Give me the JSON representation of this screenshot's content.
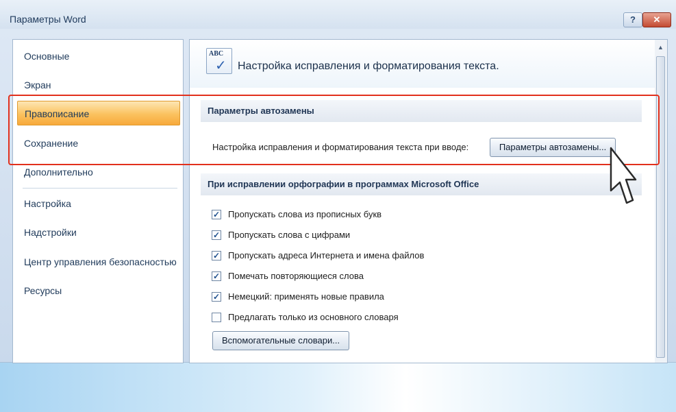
{
  "window": {
    "title": "Параметры Word",
    "help_label": "?",
    "close_label": "✕"
  },
  "sidebar": {
    "items": [
      {
        "label": "Основные"
      },
      {
        "label": "Экран"
      },
      {
        "label": "Правописание"
      },
      {
        "label": "Сохранение"
      },
      {
        "label": "Дополнительно"
      },
      {
        "label": "Настройка"
      },
      {
        "label": "Надстройки"
      },
      {
        "label": "Центр управления безопасностью"
      },
      {
        "label": "Ресурсы"
      }
    ],
    "selected": "Правописание"
  },
  "content": {
    "header_icon": "abc-check-icon",
    "header_icon_text": "ABC",
    "header_text": "Настройка исправления и форматирования текста.",
    "autocorrect_section": {
      "title": "Параметры автозамены",
      "description": "Настройка исправления и форматирования текста при вводе:",
      "button_label": "Параметры автозамены..."
    },
    "office_section": {
      "title": "При исправлении орфографии в программах Microsoft Office",
      "options": [
        {
          "label": "Пропускать слова из прописных букв",
          "checked": true
        },
        {
          "label": "Пропускать слова с цифрами",
          "checked": true
        },
        {
          "label": "Пропускать адреса Интернета и имена файлов",
          "checked": true
        },
        {
          "label": "Помечать повторяющиеся слова",
          "checked": true
        },
        {
          "label": "Немецкий: применять новые правила",
          "checked": true
        },
        {
          "label": "Предлагать только из основного словаря",
          "checked": false
        }
      ],
      "dictionaries_button": "Вспомогательные словари..."
    }
  },
  "scrollbar": {
    "up_arrow": "▲"
  },
  "colors": {
    "selected_nav": "#fbc25f",
    "highlight_frame": "#e2301c",
    "check_mark": "#1e4f8c"
  },
  "overlay": {
    "cursor_icon": "mouse-pointer-icon"
  }
}
